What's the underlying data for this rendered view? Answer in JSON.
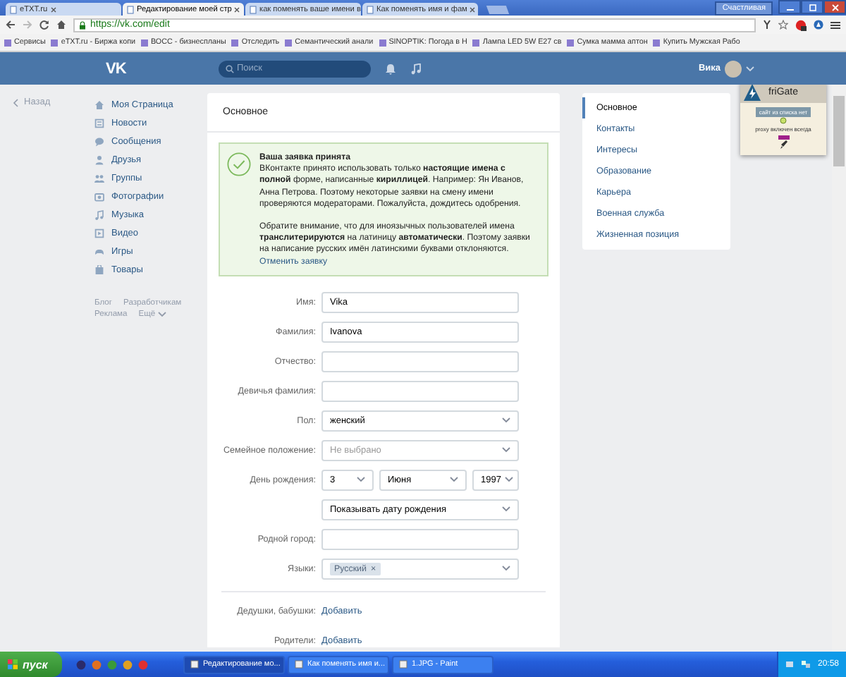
{
  "browser": {
    "tabs": [
      {
        "title": "eTXT.ru",
        "selected": false
      },
      {
        "title": "Редактирование моей стр",
        "selected": true
      },
      {
        "title": "как поменять ваше имени в",
        "selected": false
      },
      {
        "title": "Как поменять имя и фам",
        "selected": false
      }
    ],
    "profile": "Счастливая",
    "url": "https://vk.com/edit",
    "bookmarks": [
      {
        "label": "Сервисы"
      },
      {
        "label": "eTXT.ru - Биржа копи"
      },
      {
        "label": "ВОСС - бизнеспланы"
      },
      {
        "label": "Отследить"
      },
      {
        "label": "Семантический анали"
      },
      {
        "label": "SINOPTIK: Погода в Н"
      },
      {
        "label": "Лампа LED 5W E27 св"
      },
      {
        "label": "Сумка мамма аптон"
      },
      {
        "label": "Купить Мужская Рабо"
      }
    ]
  },
  "header": {
    "logo": "VK",
    "search": {
      "placeholder": "Поиск"
    },
    "user": "Вика"
  },
  "back": "Назад",
  "sidebar": {
    "items": [
      {
        "label": "Моя Страница"
      },
      {
        "label": "Новости"
      },
      {
        "label": "Сообщения"
      },
      {
        "label": "Друзья"
      },
      {
        "label": "Группы"
      },
      {
        "label": "Фотографии"
      },
      {
        "label": "Музыка"
      },
      {
        "label": "Видео"
      },
      {
        "label": "Игры"
      },
      {
        "label": "Товары"
      }
    ],
    "footer": [
      {
        "label": "Блог",
        "kind": "link"
      },
      {
        "label": "Разработчикам",
        "kind": "link"
      },
      {
        "label": "Реклама",
        "kind": "link"
      },
      {
        "label": "Ещё",
        "kind": "menu"
      }
    ]
  },
  "edit": {
    "title": "Основное",
    "notice": {
      "title": "Ваша заявка принята",
      "paragraphs": [
        "ВКонтакте принято использовать только **настоящие имена с полной** форме, написанные **кириллицей**. Например: Ян Иванов, Анна Петрова. Поэтому некоторые заявки на смену имени проверяются модераторами. Пожалуйста, дождитесь одобрения.",
        "Обратите внимание, что для иноязычных пользователей имена **транслитерируются** на латиницу **автоматически**. Поэтому заявки на написание русских имён латинскими буквами отклоняются."
      ],
      "link": "Отменить заявку"
    },
    "fields": [
      {
        "kind": "text",
        "label": "Имя:",
        "value": "Vika"
      },
      {
        "kind": "text",
        "label": "Фамилия:",
        "value": "Ivanova"
      },
      {
        "kind": "text",
        "label": "Отчество:"
      },
      {
        "kind": "text",
        "label": "Девичья фамилия:"
      },
      {
        "kind": "select",
        "label": "Пол:",
        "value": "женский"
      },
      {
        "kind": "select",
        "label": "Семейное положение:",
        "placeholder": "Не выбрано"
      },
      {
        "kind": "date",
        "label": "День рождения:",
        "parts": [
          "3",
          "Июня",
          "1997"
        ]
      },
      {
        "kind": "select",
        "value": "Показывать дату рождения"
      },
      {
        "kind": "text",
        "label": "Родной город:"
      },
      {
        "kind": "tags",
        "label": "Языки:",
        "tags": [
          {
            "label": "Русский",
            "remove": "×"
          }
        ]
      }
    ],
    "relatives": [
      {
        "label": "Дедушки, бабушки:",
        "link": "Добавить"
      },
      {
        "label": "Родители:",
        "link": "Добавить"
      }
    ]
  },
  "right_menu": {
    "items": [
      {
        "label": "Основное",
        "selected": true
      },
      {
        "label": "Контакты",
        "selected": false
      },
      {
        "label": "Интересы",
        "selected": false
      },
      {
        "label": "Образование",
        "selected": false
      },
      {
        "label": "Карьера",
        "selected": false
      },
      {
        "label": "Военная служба",
        "selected": false
      },
      {
        "label": "Жизненная позиция",
        "selected": false
      }
    ]
  },
  "frigate": {
    "title": "friGate",
    "button": "сайт из списка нет",
    "status": "proxy включен всегда"
  },
  "taskbar": {
    "start": "пуск",
    "windows": [
      {
        "title": "Редактирование мо...",
        "selected": true
      },
      {
        "title": "Как поменять имя и...",
        "selected": false
      },
      {
        "title": "1.JPG - Paint",
        "selected": false
      }
    ],
    "clock": "20:58"
  }
}
